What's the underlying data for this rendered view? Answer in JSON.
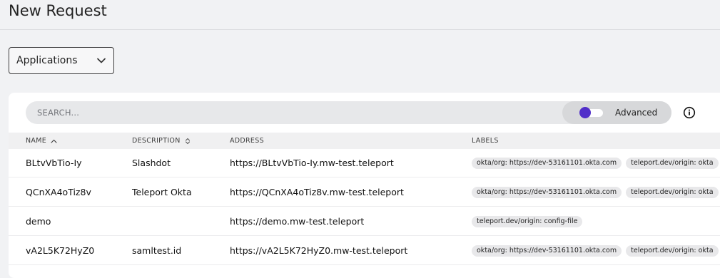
{
  "page": {
    "title": "New Request"
  },
  "resource_select": {
    "value": "Applications",
    "icon": "chevron-down-icon"
  },
  "search": {
    "placeholder": "SEARCH...",
    "value": ""
  },
  "advanced": {
    "label": "Advanced",
    "enabled": false,
    "accent_color": "#512fc9"
  },
  "info": {
    "icon": "info-icon"
  },
  "table": {
    "columns": [
      {
        "label": "NAME",
        "sort": "asc",
        "sort_icon": "chevron-up-icon"
      },
      {
        "label": "DESCRIPTION",
        "sort": "none",
        "sort_icon": "sort-toggle-icon"
      },
      {
        "label": "ADDRESS",
        "sort": "none"
      },
      {
        "label": "LABELS",
        "sort": "none"
      }
    ],
    "rows": [
      {
        "name": "BLtvVbTio-Iy",
        "description": "Slashdot",
        "address": "https://BLtvVbTio-Iy.mw-test.teleport",
        "labels": [
          "okta/org: https://dev-53161101.okta.com",
          "teleport.dev/origin: okta"
        ]
      },
      {
        "name": "QCnXA4oTiz8v",
        "description": "Teleport Okta",
        "address": "https://QCnXA4oTiz8v.mw-test.teleport",
        "labels": [
          "okta/org: https://dev-53161101.okta.com",
          "teleport.dev/origin: okta"
        ]
      },
      {
        "name": "demo",
        "description": "",
        "address": "https://demo.mw-test.teleport",
        "labels": [
          "teleport.dev/origin: config-file"
        ]
      },
      {
        "name": "vA2L5K72HyZ0",
        "description": "samltest.id",
        "address": "https://vA2L5K72HyZ0.mw-test.teleport",
        "labels": [
          "okta/org: https://dev-53161101.okta.com",
          "teleport.dev/origin: okta"
        ]
      }
    ]
  }
}
